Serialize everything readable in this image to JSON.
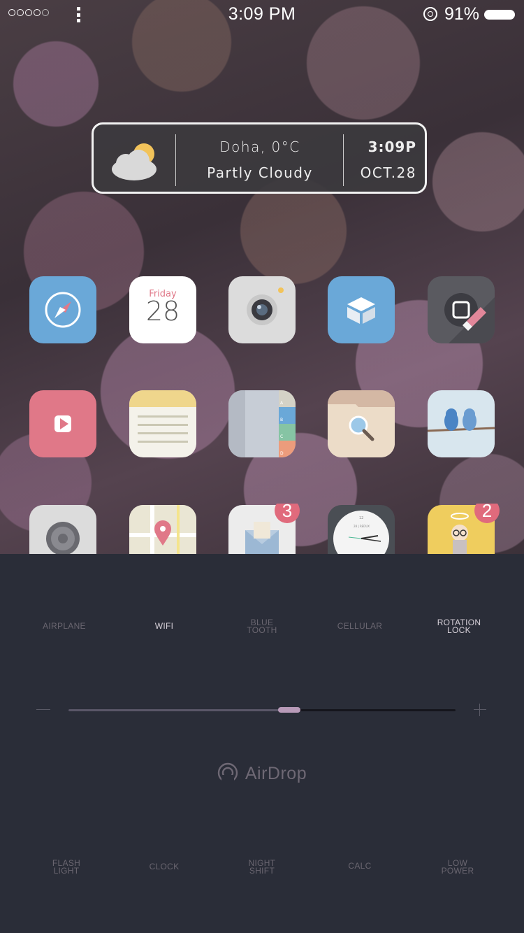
{
  "status_bar": {
    "time": "3:09 PM",
    "battery_percent": "91%",
    "signal_bars_filled": 4,
    "signal_bars_total": 5
  },
  "weather_widget": {
    "location_temp": "Doha, 0°C",
    "condition": "Partly Cloudy",
    "time": "3:09P",
    "date": "OCT.28",
    "icon": "partly-cloudy-icon"
  },
  "apps": [
    {
      "name": "safari",
      "icon": "compass-icon"
    },
    {
      "name": "calendar",
      "icon": "calendar-icon",
      "day_name": "Friday",
      "day_number": "28"
    },
    {
      "name": "camera",
      "icon": "camera-icon"
    },
    {
      "name": "dropbox",
      "icon": "box-icon"
    },
    {
      "name": "eraser",
      "icon": "eraser-icon"
    },
    {
      "name": "videos",
      "icon": "play-icon"
    },
    {
      "name": "notes",
      "icon": "notes-icon"
    },
    {
      "name": "contacts",
      "icon": "contacts-icon",
      "tabs": [
        "A",
        "B",
        "C",
        "D"
      ]
    },
    {
      "name": "finder",
      "icon": "search-folder-icon"
    },
    {
      "name": "tweetbot",
      "icon": "birds-icon"
    },
    {
      "name": "settings",
      "icon": "gear-icon"
    },
    {
      "name": "maps",
      "icon": "map-pin-icon"
    },
    {
      "name": "mail",
      "icon": "mail-icon",
      "badge": "3"
    },
    {
      "name": "clock",
      "icon": "clock-icon",
      "face_text": "12",
      "brand": "28 | REDUX"
    },
    {
      "name": "jobs",
      "icon": "portrait-icon",
      "badge": "2"
    }
  ],
  "control_center": {
    "toggles_top": [
      {
        "label": "AIRPLANE",
        "active": false
      },
      {
        "label": "WIFI",
        "active": true
      },
      {
        "label": "BLUE\nTOOTH",
        "active": false
      },
      {
        "label": "CELLULAR",
        "active": false
      },
      {
        "label": "ROTATION\nLOCK",
        "active": true
      }
    ],
    "brightness_level": 0.57,
    "airdrop_label": "AirDrop",
    "toggles_bottom": [
      {
        "label": "FLASH\nLIGHT"
      },
      {
        "label": "CLOCK"
      },
      {
        "label": "NIGHT\nSHIFT"
      },
      {
        "label": "CALC"
      },
      {
        "label": "LOW\nPOWER"
      }
    ],
    "colors": {
      "background": "#2a2d38",
      "accent": "#b89ab8",
      "inactive_text": "#6a6670"
    }
  }
}
